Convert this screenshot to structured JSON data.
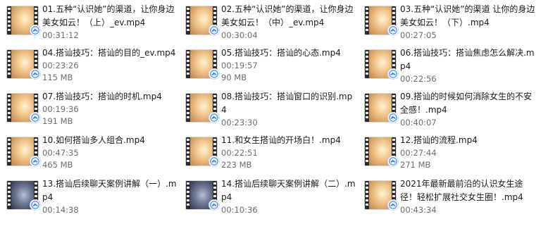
{
  "files": [
    {
      "name": "01.五种“认识她”的渠道，让你身边美女如云！（上）_ev.mp4",
      "duration": "00:31:12",
      "size": ""
    },
    {
      "name": "02.五种“认识她”的渠道，让你身边美女如云！（中）_ev.mp4",
      "duration": "00:30:04",
      "size": ""
    },
    {
      "name": "03.五种“认识她”的渠道 让你的身边美女如云！（下）.mp4",
      "duration": "00:27:05",
      "size": ""
    },
    {
      "name": "04.搭讪技巧：搭讪的目的_ev.mp4",
      "duration": "00:23:26",
      "size": "115 MB"
    },
    {
      "name": "05.搭讪技巧：搭讪的心态.mp4",
      "duration": "00:19:57",
      "size": "90 MB"
    },
    {
      "name": "06.搭讪技巧：搭讪焦虑怎么解决.mp4",
      "duration": "00:22:56",
      "size": ""
    },
    {
      "name": "07.搭讪技巧：搭讪的时机.mp4",
      "duration": "00:19:36",
      "size": "191 MB"
    },
    {
      "name": "08.搭讪技巧：搭讪窗口的识别.mp4",
      "duration": "00:23:30",
      "size": ""
    },
    {
      "name": "09.搭讪的时候如何消除女生的不安全感！.mp4",
      "duration": "00:40:07",
      "size": ""
    },
    {
      "name": "10.如何搭讪多人组合.mp4",
      "duration": "00:47:35",
      "size": "465 MB"
    },
    {
      "name": "11.和女生搭讪的开场白！.mp4",
      "duration": "00:22:51",
      "size": "223 MB"
    },
    {
      "name": "12.搭讪的流程.mp4",
      "duration": "00:27:44",
      "size": "271 MB"
    },
    {
      "name": "13.搭讪后续聊天案例讲解（一）.mp4",
      "duration": "00:14:38",
      "size": ""
    },
    {
      "name": "14.搭讪后续聊天案例讲解（二）.mp4",
      "duration": "00:10:36",
      "size": ""
    },
    {
      "name": "2021年最新最前沿的认识女生途径！轻松扩展社交女生圈！.mp4",
      "duration": "00:43:34",
      "size": ""
    }
  ],
  "thumbnail_styles": [
    "warm",
    "warm",
    "warm",
    "warm",
    "warm",
    "warm",
    "warm",
    "warm",
    "warm",
    "warm",
    "warm",
    "warm",
    "dark",
    "dark",
    "warm"
  ],
  "icons": {
    "thumbnail": "video-file-thumbnail-icon",
    "badge": "media-player-badge-icon"
  },
  "colors": {
    "name_text": "#1a1a1a",
    "detail_text": "#6d6d6d",
    "badge_blue": "#2d7be5",
    "film_strip": "#2a2a2a"
  }
}
